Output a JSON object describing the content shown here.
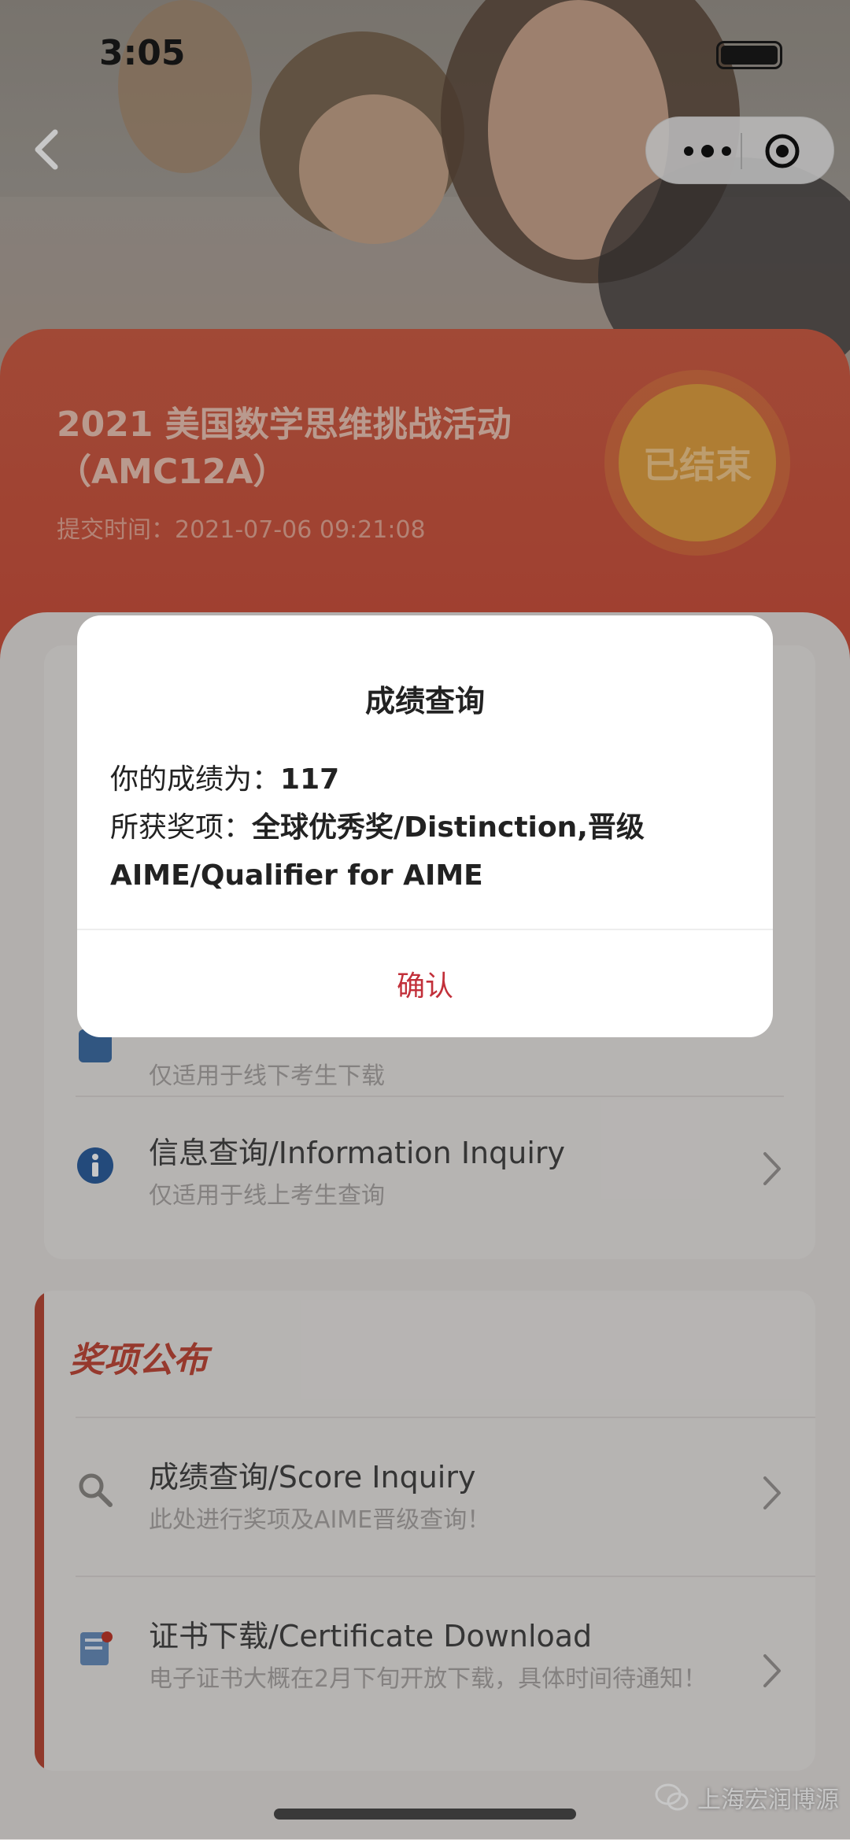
{
  "status_bar": {
    "time": "3:05"
  },
  "event": {
    "title": "2021 美国数学思维挑战活动（AMC12A）",
    "submit_time": "提交时间：2021-07-06 09:21:08",
    "status_badge": "已结束"
  },
  "list_items": [
    {
      "title": "",
      "subtitle": "仅适用于线下考生下载",
      "icon": "download-icon"
    },
    {
      "title": "信息查询/Information Inquiry",
      "subtitle": "仅适用于线上考生查询",
      "icon": "info-icon"
    }
  ],
  "awards_section": {
    "title": "奖项公布",
    "items": [
      {
        "title": "成绩查询/Score Inquiry",
        "subtitle": "此处进行奖项及AIME晋级查询！",
        "icon": "search-icon"
      },
      {
        "title": "证书下载/Certificate Download",
        "subtitle": "电子证书大概在2月下旬开放下载，具体时间待通知！",
        "icon": "certificate-icon"
      }
    ]
  },
  "modal": {
    "title": "成绩查询",
    "score_label": "你的成绩为：",
    "score_value": "117",
    "award_label": "所获奖项：",
    "award_value": "全球优秀奖/Distinction,晋级AIME/Qualifier for AIME",
    "confirm_label": "确认"
  },
  "watermark": {
    "text": "上海宏润博源"
  },
  "colors": {
    "accent_red": "#c2303a",
    "header_red": "#cd4e3b",
    "badge_orange": "#e1a042"
  }
}
